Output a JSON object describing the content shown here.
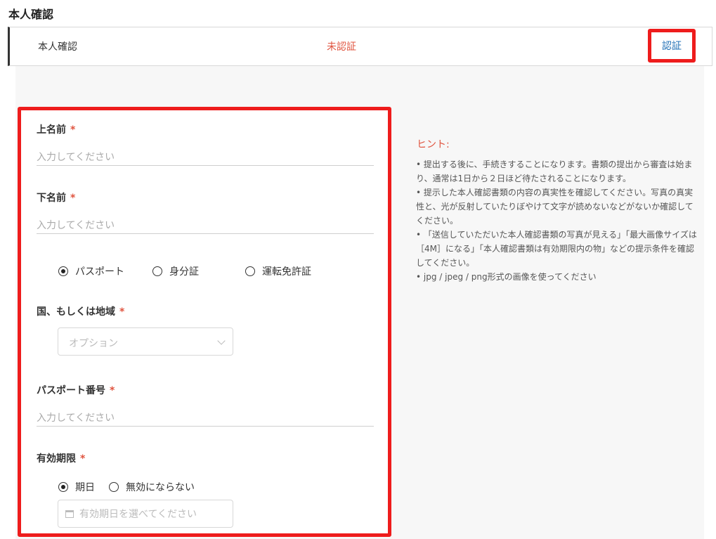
{
  "page": {
    "title": "本人確認"
  },
  "status_row": {
    "label": "本人確認",
    "status": "未認証",
    "verify_link": "認証"
  },
  "form": {
    "first_name": {
      "label": "上名前",
      "required_mark": "*",
      "placeholder": "入力してください"
    },
    "last_name": {
      "label": "下名前",
      "required_mark": "*",
      "placeholder": "入力してください"
    },
    "document_type": {
      "options": [
        {
          "label": "パスポート",
          "checked": true
        },
        {
          "label": "身分証",
          "checked": false
        },
        {
          "label": "運転免許証",
          "checked": false
        }
      ]
    },
    "country": {
      "label": "国、もしくは地域",
      "required_mark": "*",
      "placeholder": "オプション"
    },
    "passport_number": {
      "label": "パスポート番号",
      "required_mark": "*",
      "placeholder": "入力してください"
    },
    "expiry": {
      "label": "有効期限",
      "required_mark": "*",
      "options": [
        {
          "label": "期日",
          "checked": true
        },
        {
          "label": "無効にならない",
          "checked": false
        }
      ],
      "date_placeholder": "有効期日を選べてください"
    }
  },
  "hint": {
    "title": "ヒント:",
    "items": [
      "• 提出する後に、手続きすることになります。書類の提出から審査は始まり、通常は1日から２日ほど待たされることになります。",
      "• 提示した本人確認書類の内容の真実性を確認してください。写真の真実性と、光が反射していたりぼやけて文字が読めないなどがないか確認してください。",
      "• 「送信していただいた本人確認書類の写真が見える」「最大画像サイズは［4M］になる」「本人確認書類は有効期限内の物」などの提示条件を確認してください。",
      "• jpg / jpeg / png形式の画像を使ってください"
    ]
  },
  "colors": {
    "accent_red": "#e0543f",
    "highlight_border": "#ee1c1c",
    "link_blue": "#1f6fb5"
  }
}
